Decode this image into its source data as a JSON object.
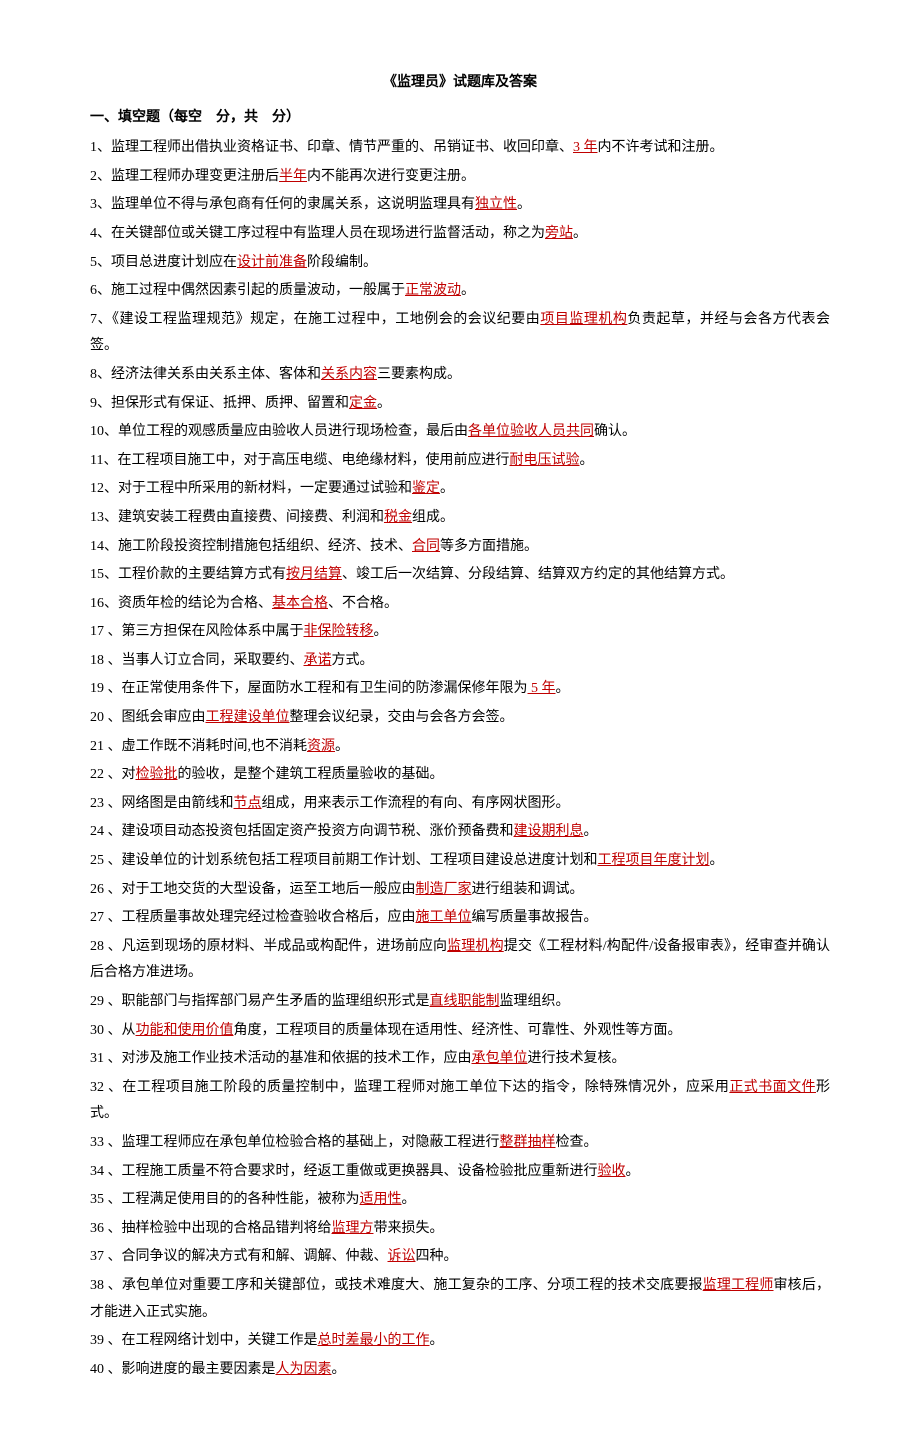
{
  "title": "《监理员》试题库及答案",
  "section_heading": "一、填空题（每空　分，共　分）",
  "items": [
    {
      "n": "1",
      "parts": [
        "、监理工程师出借执业资格证书、印章、情节严重的、吊销证书、收回印章、",
        "3 年",
        "内不许考试和注册。"
      ]
    },
    {
      "n": "2",
      "parts": [
        "、监理工程师办理变更注册后",
        "半年",
        "内不能再次进行变更注册。"
      ]
    },
    {
      "n": "3",
      "parts": [
        "、监理单位不得与承包商有任何的隶属关系，这说明监理具有",
        "独立性",
        "。"
      ]
    },
    {
      "n": "4",
      "parts": [
        "、在关键部位或关键工序过程中有监理人员在现场进行监督活动，称之为",
        "旁站",
        "。"
      ]
    },
    {
      "n": "5",
      "parts": [
        "、项目总进度计划应在",
        "设计前准备",
        "阶段编制。"
      ]
    },
    {
      "n": "6",
      "parts": [
        "、施工过程中偶然因素引起的质量波动，一般属于",
        "正常波动",
        "。"
      ]
    },
    {
      "n": "7",
      "parts": [
        "、《建设工程监理规范》规定，在施工过程中，工地例会的会议纪要由",
        "项目监理机构",
        "负责起草，并经与会各方代表会签。"
      ]
    },
    {
      "n": "8",
      "parts": [
        "、经济法律关系由关系主体、客体和",
        "关系内容",
        "三要素构成。"
      ]
    },
    {
      "n": "9",
      "parts": [
        "、担保形式有保证、抵押、质押、留置和",
        "定金",
        "。"
      ]
    },
    {
      "n": "10",
      "parts": [
        "、单位工程的观感质量应由验收人员进行现场检查，最后由",
        "各单位验收人员共同",
        "确认。"
      ]
    },
    {
      "n": "11",
      "parts": [
        "、在工程项目施工中，对于高压电缆、电绝缘材料，使用前应进行",
        "耐电压试验",
        "。"
      ]
    },
    {
      "n": "12",
      "parts": [
        "、对于工程中所采用的新材料，一定要通过试验和",
        "鉴定",
        "。"
      ]
    },
    {
      "n": "13",
      "parts": [
        "、建筑安装工程费由直接费、间接费、利润和",
        "税金",
        "组成。"
      ]
    },
    {
      "n": "14",
      "parts": [
        "、施工阶段投资控制措施包括组织、经济、技术、",
        "合同",
        "等多方面措施。"
      ]
    },
    {
      "n": "15",
      "parts": [
        "、工程价款的主要结算方式有",
        "按月结算",
        "、竣工后一次结算、分段结算、结算双方约定的其他结算方式。"
      ]
    },
    {
      "n": "16",
      "parts": [
        "、资质年检的结论为合格、",
        "基本合格",
        "、不合格。"
      ]
    },
    {
      "n": "17",
      "parts": [
        " 、第三方担保在风险体系中属于",
        "非保险转移",
        "。"
      ]
    },
    {
      "n": "18",
      "parts": [
        " 、当事人订立合同，采取要约、",
        "承诺",
        "方式。"
      ]
    },
    {
      "n": "19",
      "parts": [
        " 、在正常使用条件下，屋面防水工程和有卫生间的防渗漏保修年限为",
        " 5 年",
        "。"
      ]
    },
    {
      "n": "20",
      "parts": [
        " 、图纸会审应由",
        "工程建设单位",
        "整理会议纪录，交由与会各方会签。"
      ]
    },
    {
      "n": "21",
      "parts": [
        " 、虚工作既不消耗时间,也不消耗",
        "资源",
        "。"
      ]
    },
    {
      "n": "22",
      "parts": [
        " 、对",
        "检验批",
        "的验收，是整个建筑工程质量验收的基础。"
      ]
    },
    {
      "n": "23",
      "parts": [
        " 、网络图是由箭线和",
        "节点",
        "组成，用来表示工作流程的有向、有序网状图形。"
      ]
    },
    {
      "n": "24",
      "parts": [
        " 、建设项目动态投资包括固定资产投资方向调节税、涨价预备费和",
        "建设期利息",
        "。"
      ]
    },
    {
      "n": "25",
      "parts": [
        " 、建设单位的计划系统包括工程项目前期工作计划、工程项目建设总进度计划和",
        "工程项目年度计划",
        "。"
      ]
    },
    {
      "n": "26",
      "parts": [
        " 、对于工地交货的大型设备，运至工地后一般应由",
        "制造厂家",
        "进行组装和调试。"
      ]
    },
    {
      "n": "27",
      "parts": [
        " 、工程质量事故处理完经过检查验收合格后，应由",
        "施工单位",
        "编写质量事故报告。"
      ]
    },
    {
      "n": "28",
      "parts": [
        " 、凡运到现场的原材料、半成品或构配件，进场前应向",
        "监理机构",
        "提交《工程材料/构配件/设备报审表》，经审查并确认后合格方准进场。"
      ]
    },
    {
      "n": "29",
      "parts": [
        " 、职能部门与指挥部门易产生矛盾的监理组织形式是",
        "直线职能制",
        "监理组织。"
      ]
    },
    {
      "n": "30",
      "parts": [
        " 、从",
        "功能和使用价值",
        "角度，工程项目的质量体现在适用性、经济性、可靠性、外观性等方面。"
      ]
    },
    {
      "n": "31",
      "parts": [
        " 、对涉及施工作业技术活动的基准和依据的技术工作，应由",
        "承包单位",
        "进行技术复核。"
      ]
    },
    {
      "n": "32",
      "parts": [
        " 、在工程项目施工阶段的质量控制中，监理工程师对施工单位下达的指令，除特殊情况外，应采用",
        "正式书面文件",
        "形式。"
      ]
    },
    {
      "n": "33",
      "parts": [
        " 、监理工程师应在承包单位检验合格的基础上，对隐蔽工程进行",
        "整群抽样",
        "检查。"
      ]
    },
    {
      "n": "34",
      "parts": [
        " 、工程施工质量不符合要求时，经返工重做或更换器具、设备检验批应重新进行",
        "验收",
        "。"
      ]
    },
    {
      "n": "35",
      "parts": [
        " 、工程满足使用目的的各种性能，被称为",
        "适用性",
        "。"
      ]
    },
    {
      "n": "36",
      "parts": [
        " 、抽样检验中出现的合格品错判将给",
        "监理方",
        "带来损失。"
      ]
    },
    {
      "n": "37",
      "parts": [
        " 、合同争议的解决方式有和解、调解、仲裁、",
        "诉讼",
        "四种。"
      ]
    },
    {
      "n": "38",
      "parts": [
        " 、承包单位对重要工序和关键部位，或技术难度大、施工复杂的工序、分项工程的技术交底要报",
        "监理工程师",
        "审核后，才能进入正式实施。"
      ]
    },
    {
      "n": "39",
      "parts": [
        " 、在工程网络计划中，关键工作是",
        "总时差最小的工作",
        "。"
      ]
    },
    {
      "n": "40",
      "parts": [
        " 、影响进度的最主要因素是",
        "人为因素",
        "。"
      ]
    }
  ]
}
